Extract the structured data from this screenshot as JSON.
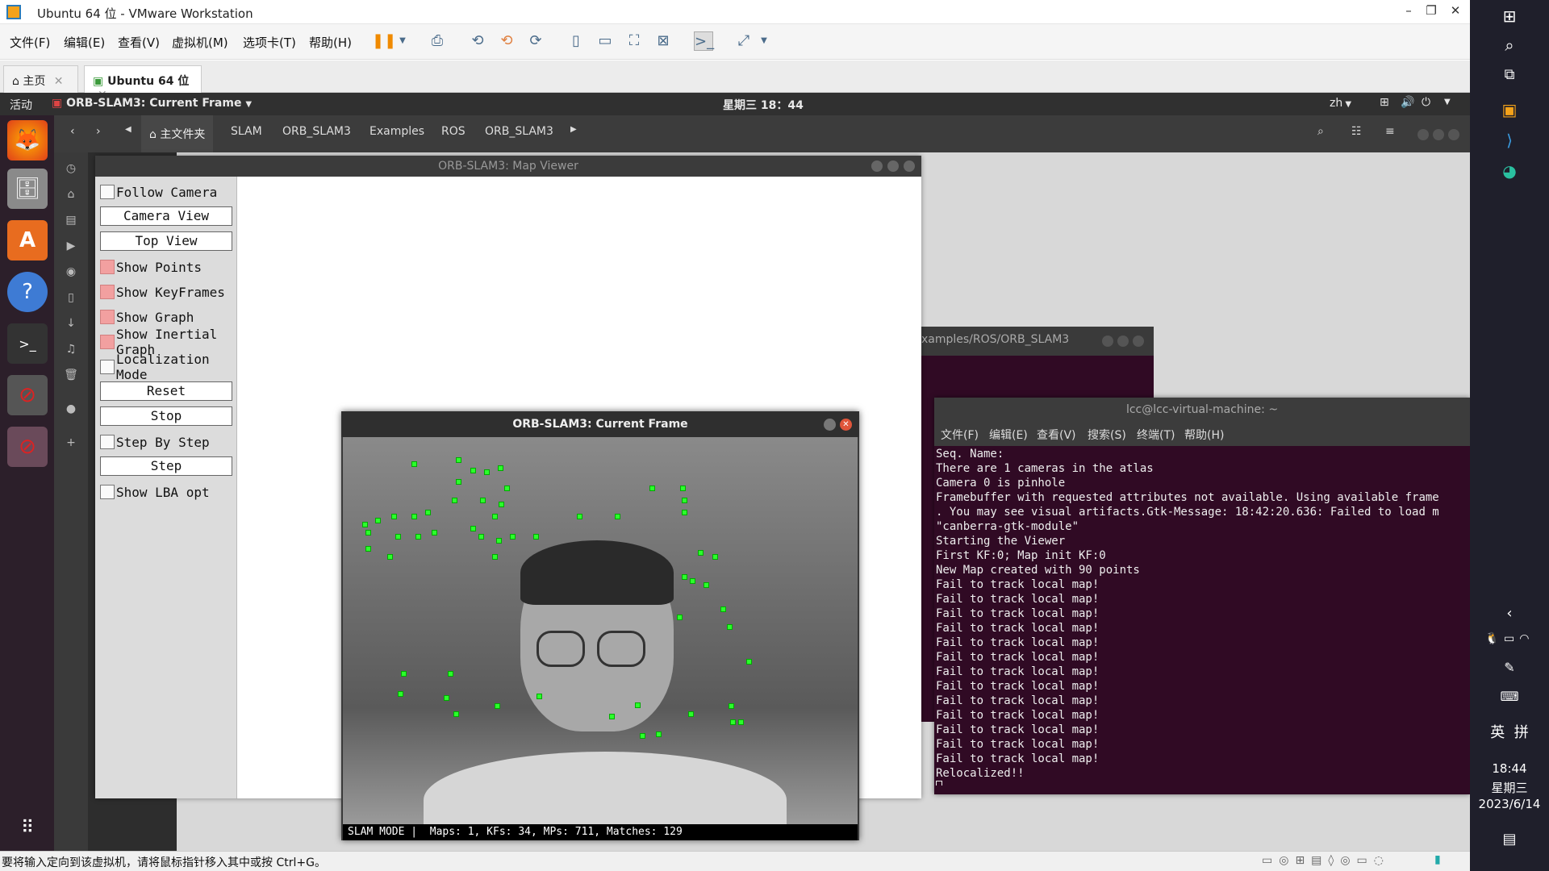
{
  "host": {
    "title": "Ubuntu 64 位 - VMware Workstation",
    "menu": [
      "文件(F)",
      "编辑(E)",
      "查看(V)",
      "虚拟机(M)",
      "选项卡(T)",
      "帮助(H)"
    ],
    "tabs": [
      {
        "label": "主页"
      },
      {
        "label": "Ubuntu 64 位"
      }
    ],
    "status_message": "要将输入定向到该虚拟机，请将鼠标指针移入其中或按 Ctrl+G。"
  },
  "gnome": {
    "activities": "活动",
    "app_menu": "ORB-SLAM3: Current Frame",
    "clock": "星期三 18：44",
    "lang": "zh"
  },
  "nautilus": {
    "breadcrumbs": [
      "主文件夹",
      "SLAM",
      "ORB_SLAM3",
      "Examples",
      "ROS",
      "ORB_SLAM3"
    ]
  },
  "map_viewer": {
    "title": "ORB-SLAM3: Map Viewer",
    "controls": [
      {
        "type": "checkbox",
        "label": "Follow Camera",
        "checked": false
      },
      {
        "type": "button",
        "label": "Camera View"
      },
      {
        "type": "button",
        "label": "Top View"
      },
      {
        "type": "checkbox",
        "label": "Show Points",
        "checked": true
      },
      {
        "type": "checkbox",
        "label": "Show KeyFrames",
        "checked": true
      },
      {
        "type": "checkbox",
        "label": "Show Graph",
        "checked": true
      },
      {
        "type": "checkbox",
        "label": "Show Inertial Graph",
        "checked": true
      },
      {
        "type": "checkbox",
        "label": "Localization Mode",
        "checked": false
      },
      {
        "type": "button",
        "label": "Reset"
      },
      {
        "type": "button",
        "label": "Stop"
      },
      {
        "type": "checkbox",
        "label": "Step By Step",
        "checked": false
      },
      {
        "type": "button",
        "label": "Step"
      },
      {
        "type": "checkbox",
        "label": "Show LBA opt",
        "checked": false
      }
    ]
  },
  "current_frame": {
    "title": "ORB-SLAM3: Current Frame",
    "status": "SLAM MODE |  Maps: 1, KFs: 34, MPs: 711, Matches: 129"
  },
  "terminal_back": {
    "title": "xamples/ROS/ORB_SLAM3"
  },
  "terminal": {
    "title": "lcc@lcc-virtual-machine: ~",
    "menu": [
      "文件(F)",
      "编辑(E)",
      "查看(V)",
      "搜索(S)",
      "终端(T)",
      "帮助(H)"
    ],
    "lines": [
      "Seq. Name:",
      "There are 1 cameras in the atlas",
      "Camera 0 is pinhole",
      "Framebuffer with requested attributes not available. Using available frame",
      ". You may see visual artifacts.Gtk-Message: 18:42:20.636: Failed to load m",
      "\"canberra-gtk-module\"",
      "Starting the Viewer",
      "First KF:0; Map init KF:0",
      "New Map created with 90 points",
      "Fail to track local map!",
      "Fail to track local map!",
      "Fail to track local map!",
      "Fail to track local map!",
      "Fail to track local map!",
      "Fail to track local map!",
      "Fail to track local map!",
      "Fail to track local map!",
      "Fail to track local map!",
      "Fail to track local map!",
      "Fail to track local map!",
      "Fail to track local map!",
      "Fail to track local map!",
      "Relocalized!!"
    ]
  },
  "taskbar": {
    "ime1": "英",
    "ime2": "拼",
    "time": "18:44",
    "weekday": "星期三",
    "date": "2023/6/14"
  }
}
